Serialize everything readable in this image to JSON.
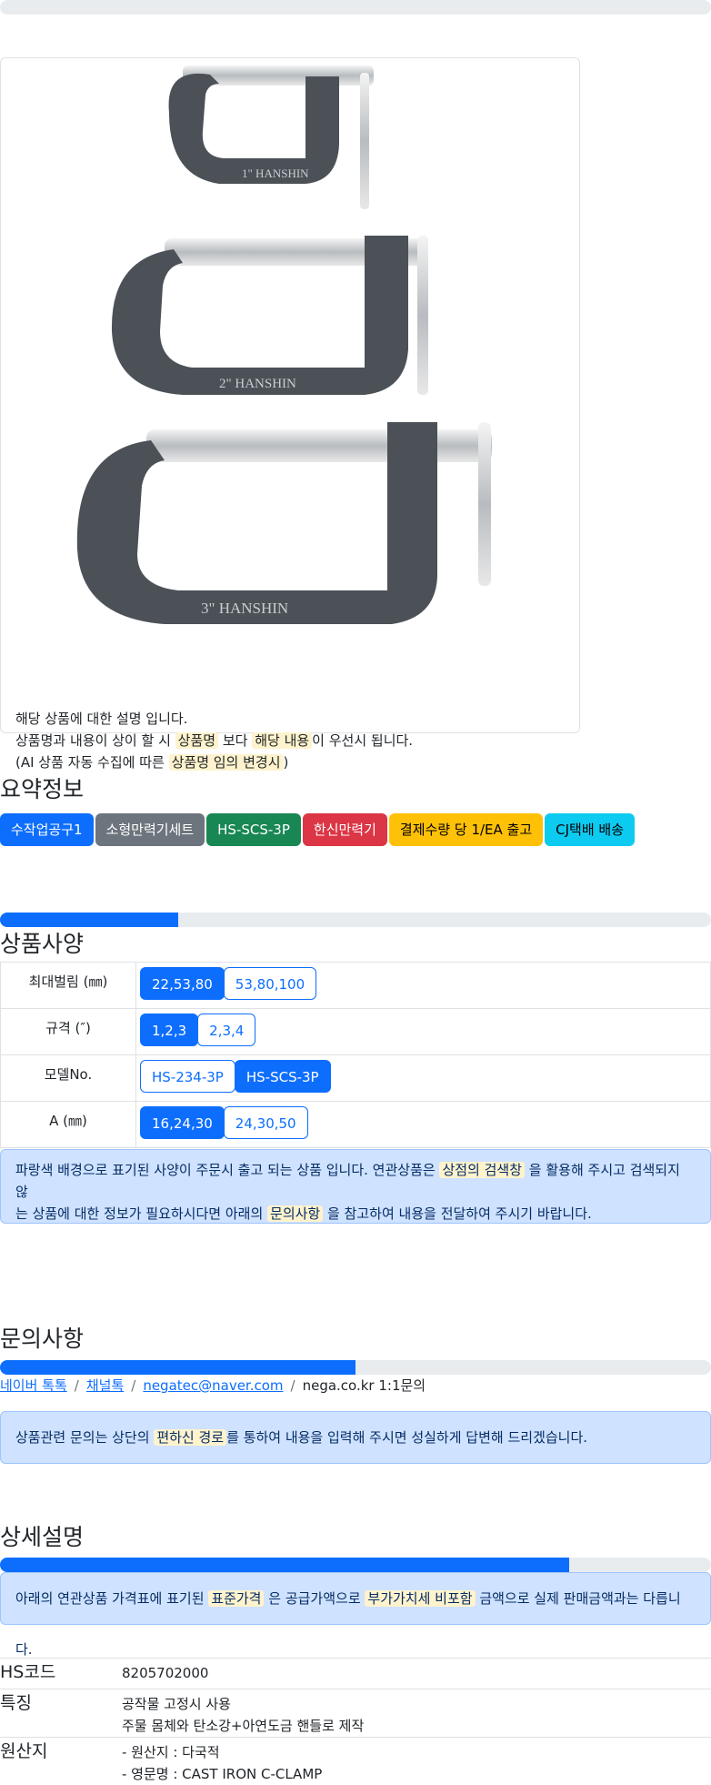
{
  "top_progress": {
    "value": 0
  },
  "product_image": {
    "clamp_labels": [
      "1\" HANSHIN",
      "2\" HANSHIN",
      "3\" HANSHIN"
    ],
    "description_lines": [
      {
        "pre": "해당 상품에 대한 설명 입니다.",
        "hl1": "",
        "mid": "",
        "hl2": "",
        "post": ""
      },
      {
        "pre": "상품명과 내용이 상이 할 시 ",
        "hl1": "상품명",
        "mid": " 보다 ",
        "hl2": "해당 내용",
        "post": "이 우선시 됩니다."
      },
      {
        "pre": "(AI 상품 자동 수집에 따른 ",
        "hl1": "상품명 임의 변경시",
        "mid": ")",
        "hl2": "",
        "post": ""
      }
    ]
  },
  "summary": {
    "title": "요약정보",
    "badges": [
      {
        "label": "수작업공구1",
        "color": "#0d6efd",
        "text_color": "#ffffff"
      },
      {
        "label": "소형만력기세트",
        "color": "#6c757d",
        "text_color": "#ffffff"
      },
      {
        "label": "HS-SCS-3P",
        "color": "#198754",
        "text_color": "#ffffff"
      },
      {
        "label": "한신만력기",
        "color": "#dc3545",
        "text_color": "#ffffff"
      },
      {
        "label": "결제수량 당 1/EA 출고",
        "color": "#ffc107",
        "text_color": "#000000"
      },
      {
        "label": "CJ택배 배송",
        "color": "#0dcaf0",
        "text_color": "#000000"
      }
    ]
  },
  "spec": {
    "progress": 0.25,
    "title": "상품사양",
    "rows": [
      {
        "key": "최대벌림 (㎜)",
        "options": [
          {
            "label": "22,53,80",
            "selected": true
          },
          {
            "label": "53,80,100",
            "selected": false
          }
        ]
      },
      {
        "key": "규격 (″)",
        "options": [
          {
            "label": "1,2,3",
            "selected": true
          },
          {
            "label": "2,3,4",
            "selected": false
          }
        ]
      },
      {
        "key": "모델No.",
        "options": [
          {
            "label": "HS-234-3P",
            "selected": false
          },
          {
            "label": "HS-SCS-3P",
            "selected": true
          }
        ]
      },
      {
        "key": "A (㎜)",
        "options": [
          {
            "label": "16,24,30",
            "selected": true
          },
          {
            "label": "24,30,50",
            "selected": false
          }
        ]
      }
    ],
    "notice": {
      "l1_pre": "파랑색 배경으로 표기된 사양이 주문시 출고 되는 상품 입니다. 연관상품은 ",
      "l1_hl": "상점의 검색창",
      "l1_post": " 을 활용해 주시고 검색되지 않",
      "l2_pre": "는 상품에 대한 정보가 필요하시다면 아래의 ",
      "l2_hl": "문의사항",
      "l2_post": " 을 참고하여 내용을 전달하여 주시기 바랍니다."
    }
  },
  "inquiry": {
    "title": "문의사항",
    "progress": 0.5,
    "links": [
      "네이버 톡톡",
      "채널톡",
      "negatec@naver.com"
    ],
    "plain": "nega.co.kr 1:1문의",
    "notice": {
      "pre": "상품관련 문의는 상단의 ",
      "hl": "편하신 경로",
      "post": "를 통하여 내용을 입력해 주시면 성실하게 답변해 드리겠습니다."
    }
  },
  "detail": {
    "title": "상세설명",
    "progress": 0.8,
    "notice": {
      "pre": "아래의 연관상품 가격표에 표기된 ",
      "hl1": "표준가격",
      "mid": " 은 공급가액으로 ",
      "hl2": "부가가치세 비포함",
      "post": " 금액으로 실제 판매금액과는 다릅니다."
    },
    "rows": [
      {
        "key": "HS코드",
        "values": [
          "8205702000"
        ]
      },
      {
        "key": "특징",
        "values": [
          "공작물 고정시 사용",
          "주물 몸체와 탄소강+아연도금 핸들로 제작"
        ]
      },
      {
        "key": "원산지",
        "values": [
          "- 원산지 : 다국적",
          "- 영문명 : CAST IRON C-CLAMP"
        ]
      }
    ]
  }
}
